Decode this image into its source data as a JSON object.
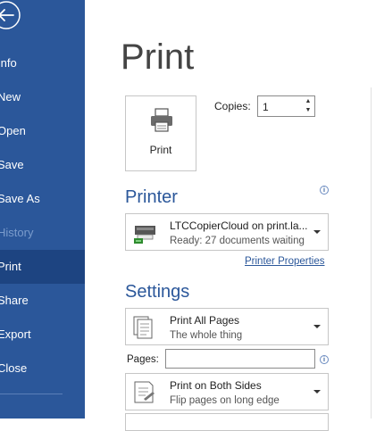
{
  "sidebar": {
    "items": [
      {
        "label": "Info",
        "state": "normal"
      },
      {
        "label": "New",
        "state": "normal"
      },
      {
        "label": "Open",
        "state": "normal"
      },
      {
        "label": "Save",
        "state": "normal"
      },
      {
        "label": "Save As",
        "state": "normal"
      },
      {
        "label": "History",
        "state": "disabled"
      },
      {
        "label": "Print",
        "state": "active"
      },
      {
        "label": "Share",
        "state": "normal"
      },
      {
        "label": "Export",
        "state": "normal"
      },
      {
        "label": "Close",
        "state": "normal"
      }
    ],
    "back_icon": "back-arrow-icon"
  },
  "main": {
    "title": "Print",
    "print_button_label": "Print",
    "copies": {
      "label": "Copies:",
      "value": "1"
    },
    "printer": {
      "heading": "Printer",
      "name": "LTCCopierCloud on print.la...",
      "status": "Ready: 27 documents waiting",
      "properties_link": "Printer Properties"
    },
    "settings": {
      "heading": "Settings",
      "print_range": {
        "main": "Print All Pages",
        "sub": "The whole thing"
      },
      "pages_label": "Pages:",
      "pages_value": "",
      "duplex": {
        "main": "Print on Both Sides",
        "sub": "Flip pages on long edge"
      }
    }
  },
  "colors": {
    "accent": "#2b579a",
    "sidebar_active": "#1d4481"
  }
}
